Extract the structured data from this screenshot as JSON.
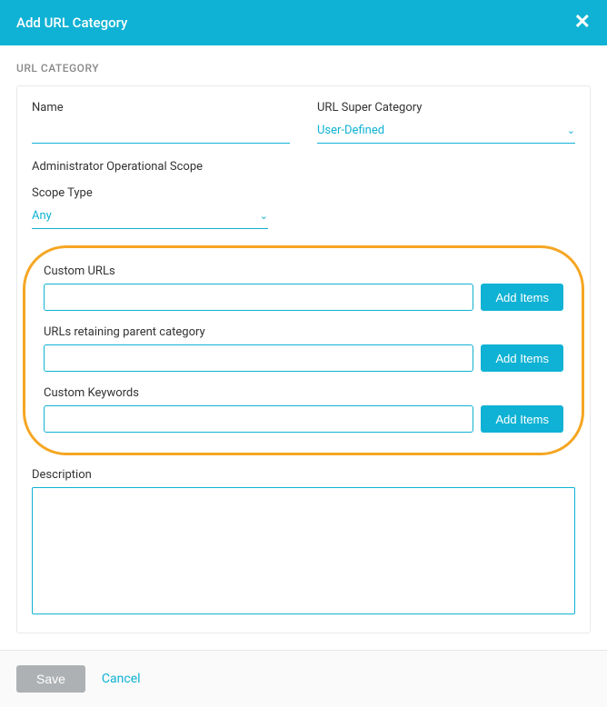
{
  "header": {
    "title": "Add URL Category",
    "close": "✕"
  },
  "section_label": "URL CATEGORY",
  "fields": {
    "name": {
      "label": "Name",
      "value": ""
    },
    "super_category": {
      "label": "URL Super Category",
      "selected": "User-Defined"
    },
    "admin_scope_label": "Administrator Operational Scope",
    "scope_type": {
      "label": "Scope Type",
      "selected": "Any"
    },
    "custom_urls": {
      "label": "Custom URLs",
      "value": "",
      "add_button": "Add Items"
    },
    "urls_parent": {
      "label": "URLs retaining parent category",
      "value": "",
      "add_button": "Add Items"
    },
    "custom_keywords": {
      "label": "Custom Keywords",
      "value": "",
      "add_button": "Add Items"
    },
    "description": {
      "label": "Description",
      "value": ""
    }
  },
  "footer": {
    "save": "Save",
    "cancel": "Cancel"
  }
}
